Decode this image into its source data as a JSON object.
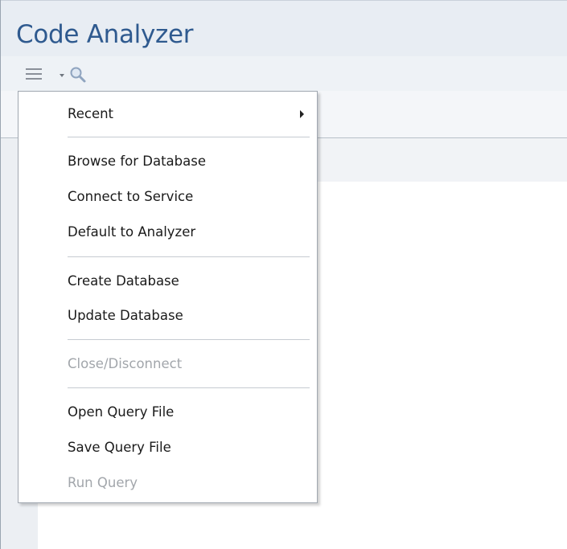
{
  "window": {
    "title": "Code Analyzer"
  },
  "toolbar": {
    "menu_icon": "hamburger-menu-icon",
    "dropdown_icon": "chevron-down-icon",
    "search_icon": "search-icon"
  },
  "menu": {
    "items": [
      {
        "label": "Recent",
        "enabled": true,
        "has_submenu": true
      },
      {
        "label": "Browse for Database",
        "enabled": true
      },
      {
        "label": "Connect to Service",
        "enabled": true
      },
      {
        "label": "Default to Analyzer",
        "enabled": true
      },
      {
        "label": "Create Database",
        "enabled": true
      },
      {
        "label": "Update Database",
        "enabled": true
      },
      {
        "label": "Close/Disconnect",
        "enabled": false
      },
      {
        "label": "Open Query File",
        "enabled": true
      },
      {
        "label": "Save Query File",
        "enabled": true
      },
      {
        "label": "Run Query",
        "enabled": false
      }
    ]
  },
  "colors": {
    "title_text": "#2f5a8f",
    "disabled_text": "#a2a6ab"
  }
}
